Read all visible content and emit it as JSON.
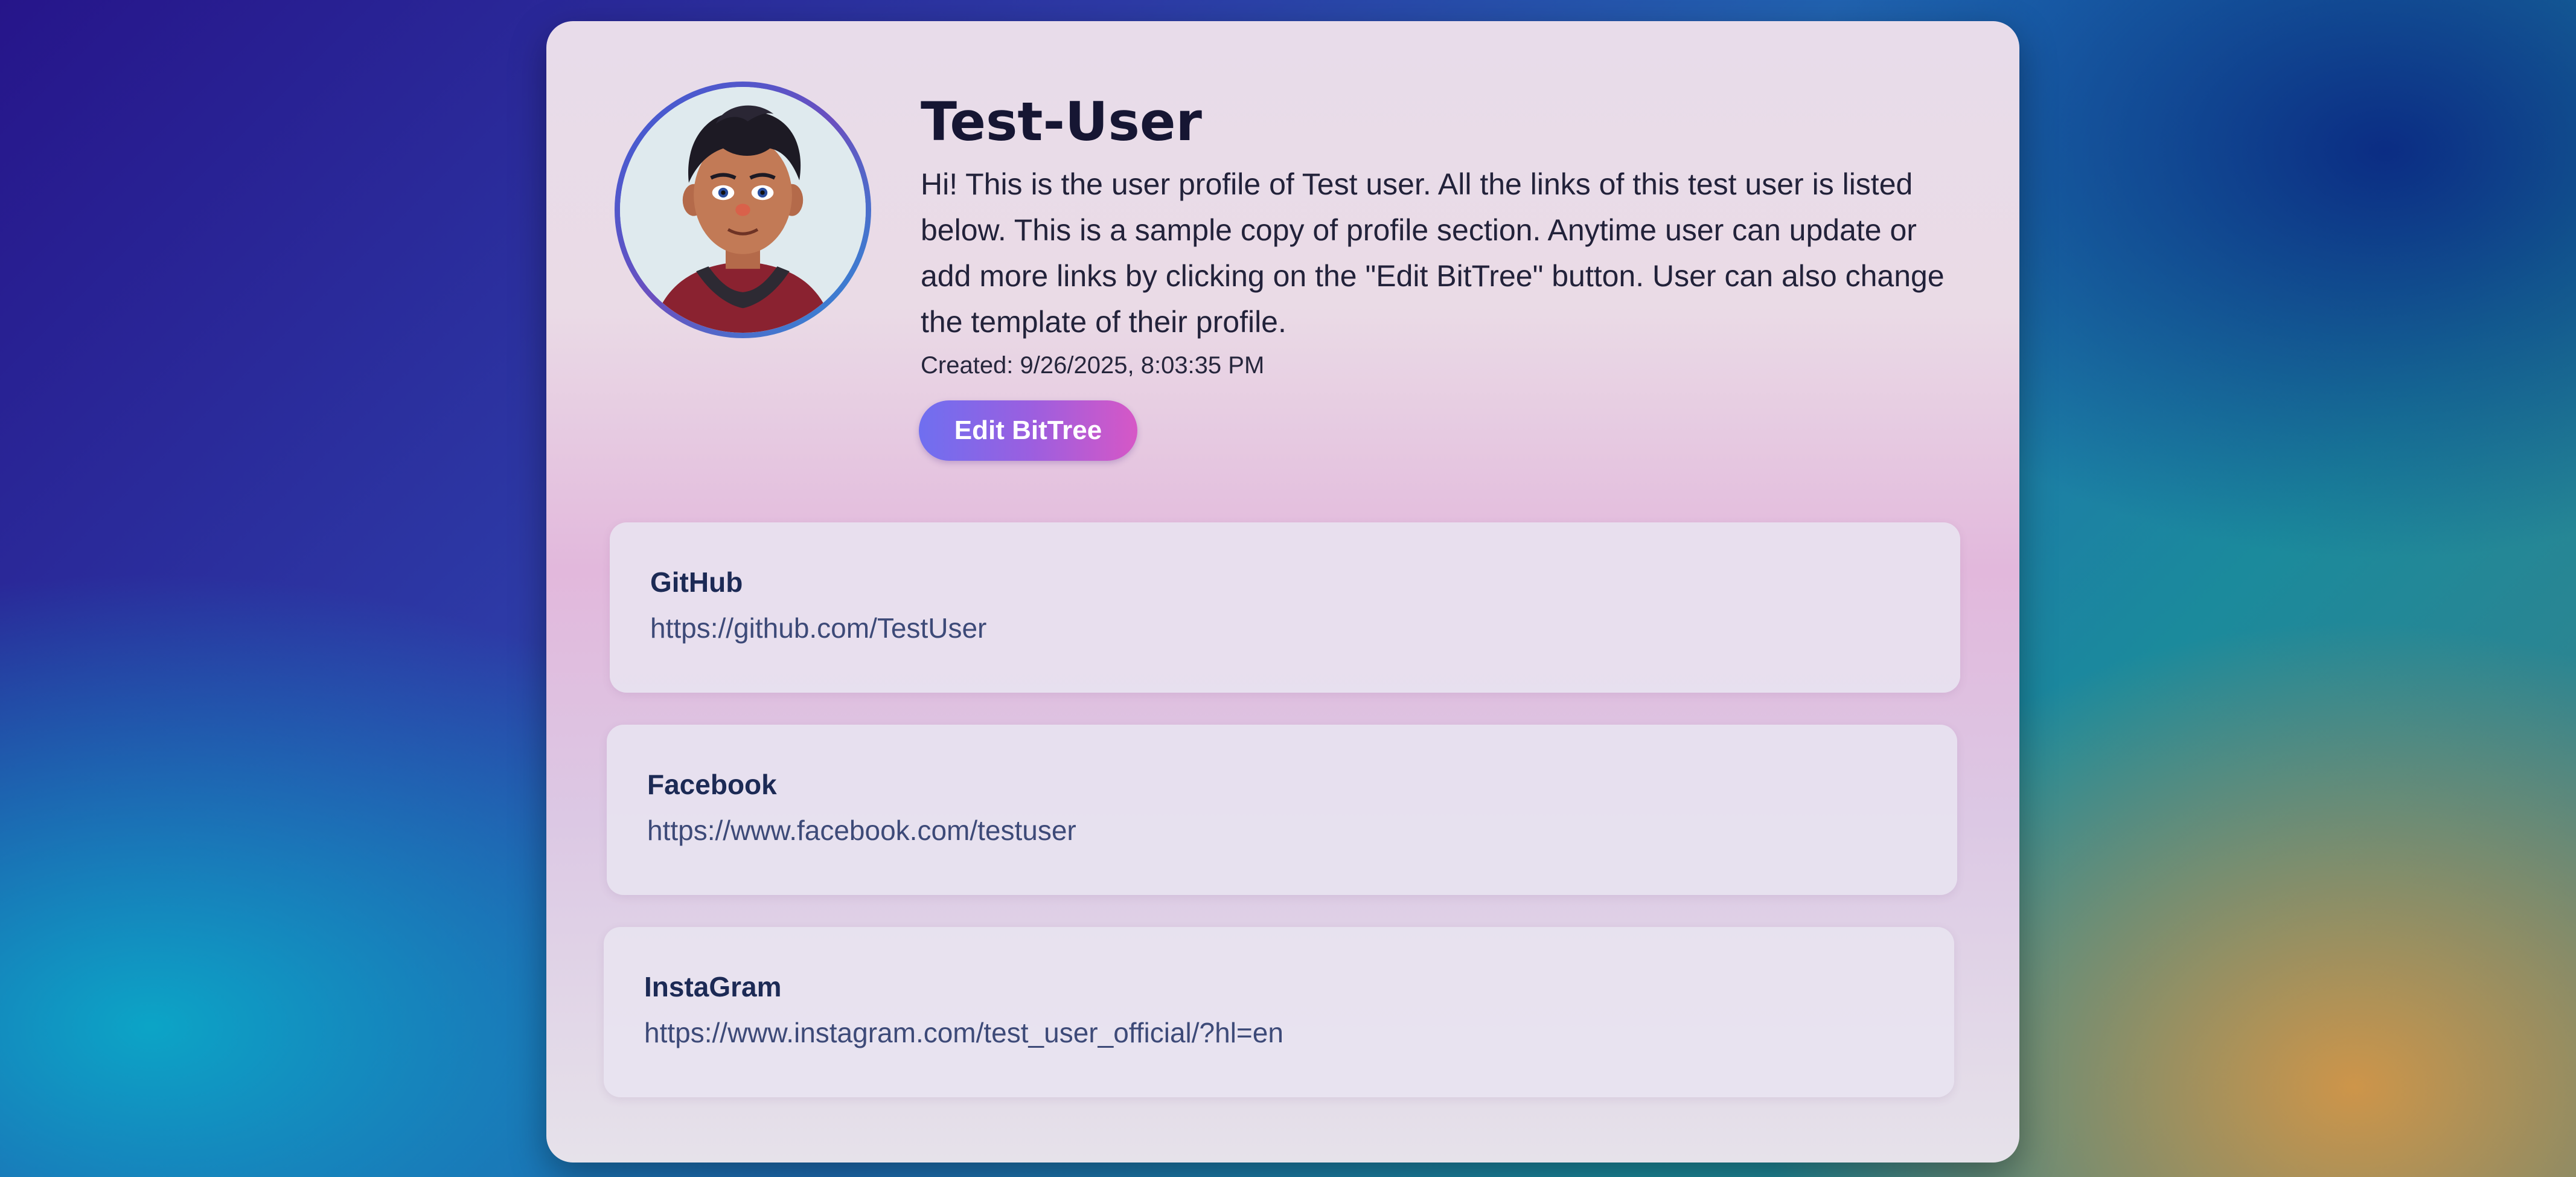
{
  "profile": {
    "name": "Test-User",
    "bio": "Hi! This is the user profile of Test user. All the links of this test user is listed below. This is a sample copy of profile section. Anytime user can update or add more links by clicking on the \"Edit BitTree\" button. User can also change the template of their profile.",
    "created": "Created: 9/26/2025, 8:03:35 PM",
    "edit_button_label": "Edit BitTree",
    "avatar_icon": "cartoon-user-avatar"
  },
  "links": [
    {
      "name": "GitHub",
      "url": "https://github.com/TestUser"
    },
    {
      "name": "Facebook",
      "url": "https://www.facebook.com/testuser"
    },
    {
      "name": "InstaGram",
      "url": "https://www.instagram.com/test_user_official/?hl=en"
    }
  ],
  "colors": {
    "button_gradient_start": "#6f6ff0",
    "button_gradient_end": "#d657c6",
    "title_text": "#161633",
    "link_title": "#1c2a55",
    "link_url": "#3d4a78"
  }
}
